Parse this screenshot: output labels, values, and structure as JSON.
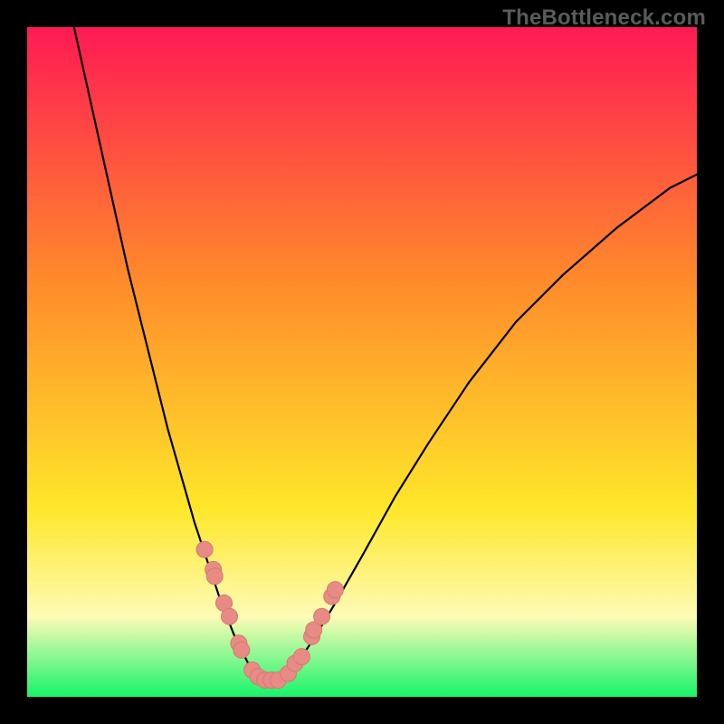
{
  "watermark": "TheBottleneck.com",
  "chart_data": {
    "type": "line",
    "title": "",
    "xlabel": "",
    "ylabel": "",
    "xlim": [
      0,
      100
    ],
    "ylim": [
      0,
      100
    ],
    "curve": {
      "x": [
        7,
        9,
        11,
        13,
        15,
        17,
        19,
        21,
        23,
        25,
        27,
        29,
        31,
        32,
        33,
        34,
        35,
        37,
        39,
        41,
        43,
        46,
        50,
        55,
        60,
        66,
        73,
        80,
        88,
        96,
        100
      ],
      "y": [
        100,
        91,
        82,
        73,
        64,
        56,
        48,
        40,
        33,
        26,
        20,
        14,
        9,
        7,
        5,
        4,
        3,
        3,
        4,
        6,
        9,
        14,
        21,
        30,
        38,
        47,
        56,
        63,
        70,
        76,
        78
      ]
    },
    "dots": {
      "x": [
        26.5,
        27.8,
        28.0,
        29.4,
        30.2,
        31.6,
        32.0,
        33.6,
        34.5,
        35.5,
        36.5,
        37.5,
        39.0,
        40.0,
        41.0,
        42.5,
        42.8,
        44.0,
        45.5,
        46.0
      ],
      "y": [
        22,
        19,
        18,
        14,
        12,
        8,
        7,
        4,
        3,
        2.5,
        2.5,
        2.5,
        3.5,
        5,
        6,
        9,
        10,
        12,
        15,
        16
      ]
    },
    "annotations": [],
    "legend": [],
    "grid": false,
    "background_gradient": {
      "top": "#ff1a54",
      "mid1": "#ff8b2b",
      "mid2": "#ffe72a",
      "band": "#fdfbb6",
      "bottom": "#17f46a"
    }
  },
  "colors": {
    "frame": "#000000",
    "curve": "#000000",
    "dot_fill": "#e88b84",
    "dot_stroke": "#d47a73"
  }
}
